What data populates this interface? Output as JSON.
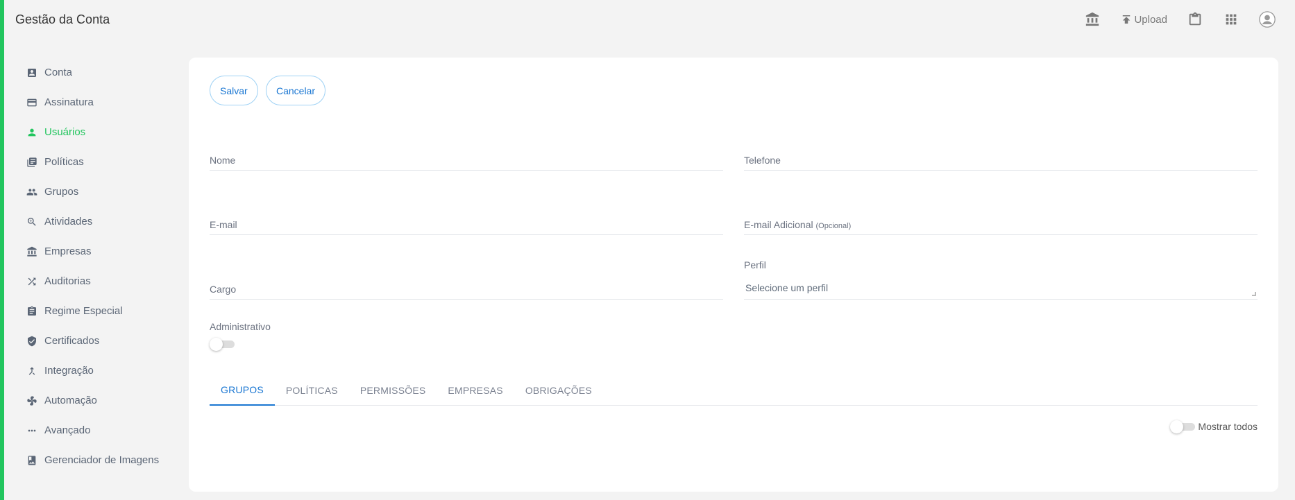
{
  "header": {
    "title": "Gestão da Conta",
    "upload_label": "Upload",
    "icons": [
      "bank-icon",
      "upload-icon",
      "clipboard-icon",
      "apps-grid-icon",
      "account-circle-icon"
    ]
  },
  "sidebar": {
    "items": [
      {
        "label": "Conta",
        "icon": "account-box-icon"
      },
      {
        "label": "Assinatura",
        "icon": "credit-card-icon"
      },
      {
        "label": "Usuários",
        "icon": "person-icon",
        "active": true
      },
      {
        "label": "Políticas",
        "icon": "library-books-icon"
      },
      {
        "label": "Grupos",
        "icon": "people-icon"
      },
      {
        "label": "Atividades",
        "icon": "zoom-in-icon"
      },
      {
        "label": "Empresas",
        "icon": "bank-icon"
      },
      {
        "label": "Auditorias",
        "icon": "shuffle-icon"
      },
      {
        "label": "Regime Especial",
        "icon": "assignment-icon"
      },
      {
        "label": "Certificados",
        "icon": "verified-shield-icon"
      },
      {
        "label": "Integração",
        "icon": "merge-icon"
      },
      {
        "label": "Automação",
        "icon": "fan-icon"
      },
      {
        "label": "Avançado",
        "icon": "more-horiz-icon"
      },
      {
        "label": "Gerenciador de Imagens",
        "icon": "photo-album-icon"
      }
    ]
  },
  "form": {
    "save_label": "Salvar",
    "cancel_label": "Cancelar",
    "nome_label": "Nome",
    "telefone_label": "Telefone",
    "email_label": "E-mail",
    "email_adicional_label": "E-mail Adicional",
    "opcional_label": "(Opcional)",
    "cargo_label": "Cargo",
    "perfil_label": "Perfil",
    "perfil_placeholder": "Selecione um perfil",
    "administrativo_label": "Administrativo"
  },
  "tabs": [
    {
      "label": "GRUPOS",
      "active": true
    },
    {
      "label": "POLÍTICAS"
    },
    {
      "label": "PERMISSÕES"
    },
    {
      "label": "EMPRESAS"
    },
    {
      "label": "OBRIGAÇÕES"
    }
  ],
  "show_all_label": "Mostrar todos",
  "colors": {
    "accent": "#22c55e",
    "primary": "#1976d2"
  }
}
